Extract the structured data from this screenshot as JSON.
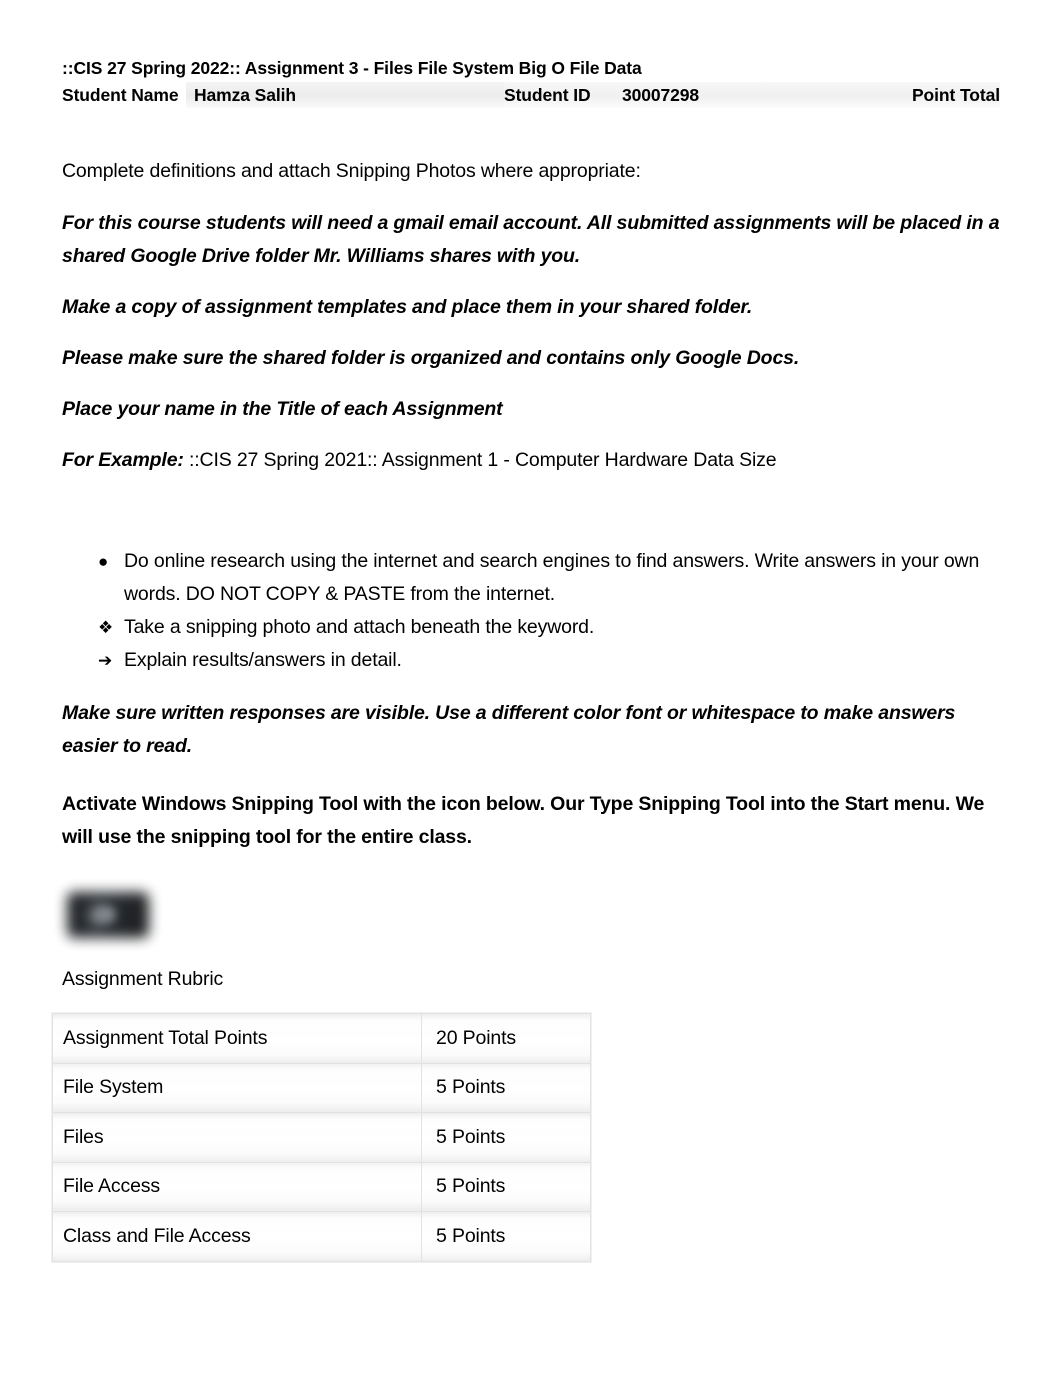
{
  "document": {
    "header": {
      "title_line": "::CIS 27 Spring 2022:: Assignment 3 - Files  File System Big O File Data",
      "student_name_label": "Student Name",
      "student_name_value": "Hamza Salih",
      "student_id_label": "Student ID",
      "student_id_value": "30007298",
      "point_total_label": "Point Total"
    },
    "intro": "Complete definitions and attach Snipping Photos where appropriate:",
    "instructions": [
      "For this course students will need a gmail email account. All submitted assignments will be placed in a shared Google Drive folder Mr. Williams shares with you.",
      "Make a copy of assignment templates and place them in your shared folder.",
      "Please make sure the shared folder is organized and contains only Google Docs.",
      "Place your name in the Title of each Assignment"
    ],
    "example": {
      "label": "For Example:",
      "text": " ::CIS 27 Spring 2021:: Assignment 1 - Computer Hardware Data Size"
    },
    "bullets": [
      {
        "marker": "filled-circle-bullet",
        "glyph": "●",
        "text": "Do online research using the internet and search engines to find answers. Write answers in your own words. DO NOT COPY & PASTE from the internet."
      },
      {
        "marker": "diamond-bullet",
        "glyph": "❖",
        "text": "Take a snipping photo and attach beneath the keyword."
      },
      {
        "marker": "arrow-bullet",
        "glyph": "➔",
        "text": "Explain results/answers in detail."
      }
    ],
    "green_note": "Make sure written responses are visible. Use a different color font or whitespace to make answers easier to read.",
    "green_note_color": "#3b7c23",
    "snipping_note": "Activate Windows Snipping Tool with the icon below. Our Type Snipping Tool into the Start menu. We will use the snipping tool for the entire class.",
    "snipping_icon_name": "snipping-tool-icon",
    "rubric": {
      "label": "Assignment Rubric",
      "rows": [
        {
          "criterion": "Assignment Total Points",
          "points": "20 Points"
        },
        {
          "criterion": "File System",
          "points": "5 Points"
        },
        {
          "criterion": "Files",
          "points": "5 Points"
        },
        {
          "criterion": "File Access",
          "points": "5 Points"
        },
        {
          "criterion": "Class and File Access",
          "points": "5 Points"
        }
      ]
    }
  }
}
